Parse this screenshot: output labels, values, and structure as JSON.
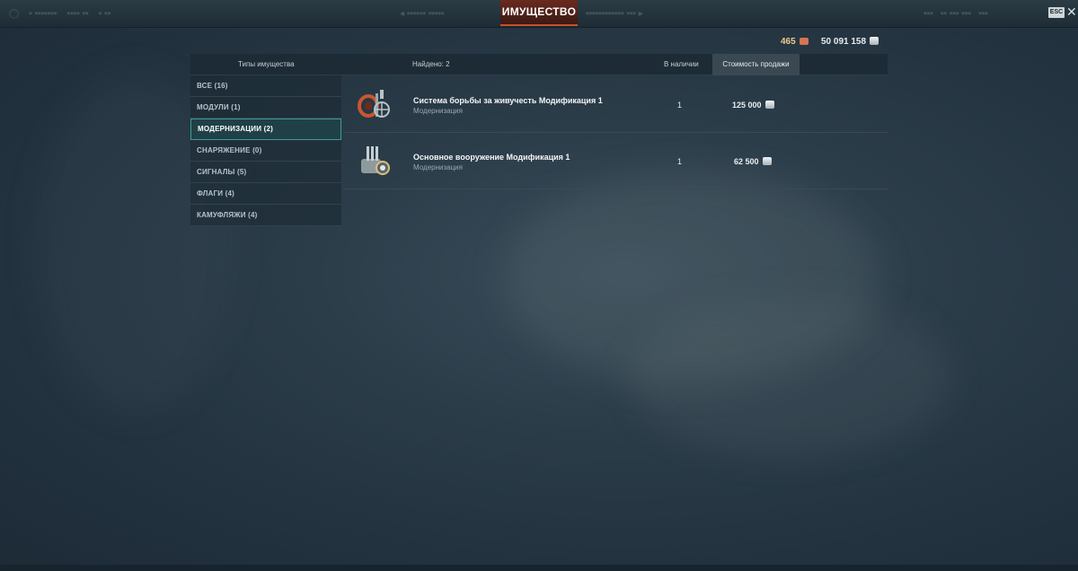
{
  "window": {
    "title": "ИМУЩЕСТВО",
    "esc_label": "ESC",
    "close_glyph": "✕"
  },
  "balance": {
    "doubloons": "465",
    "credits": "50 091 158"
  },
  "table_header": {
    "types_label": "Типы имущества",
    "found_label": "Найдено: 2",
    "stock_label": "В наличии",
    "price_label": "Стоимость продажи"
  },
  "sidebar": {
    "items": [
      {
        "label": "ВСЕ (16)",
        "active": false
      },
      {
        "label": "МОДУЛИ (1)",
        "active": false
      },
      {
        "label": "МОДЕРНИЗАЦИИ (2)",
        "active": true
      },
      {
        "label": "СНАРЯЖЕНИЕ (0)",
        "active": false
      },
      {
        "label": "СИГНАЛЫ (5)",
        "active": false
      },
      {
        "label": "ФЛАГИ (4)",
        "active": false
      },
      {
        "label": "КАМУФЛЯЖИ (4)",
        "active": false
      }
    ]
  },
  "items": [
    {
      "name": "Система борьбы за живучесть Модификация 1",
      "type": "Модернизация",
      "stock": "1",
      "price": "125 000",
      "icon": "damage-control-upgrade-icon"
    },
    {
      "name": "Основное вооружение Модификация 1",
      "type": "Модернизация",
      "stock": "1",
      "price": "62 500",
      "icon": "main-battery-upgrade-icon"
    }
  ],
  "colors": {
    "accent": "#3f9a93",
    "active_tab": "#c9502a",
    "doubloons": "#f0c98a",
    "background": "#2c3d4a"
  }
}
